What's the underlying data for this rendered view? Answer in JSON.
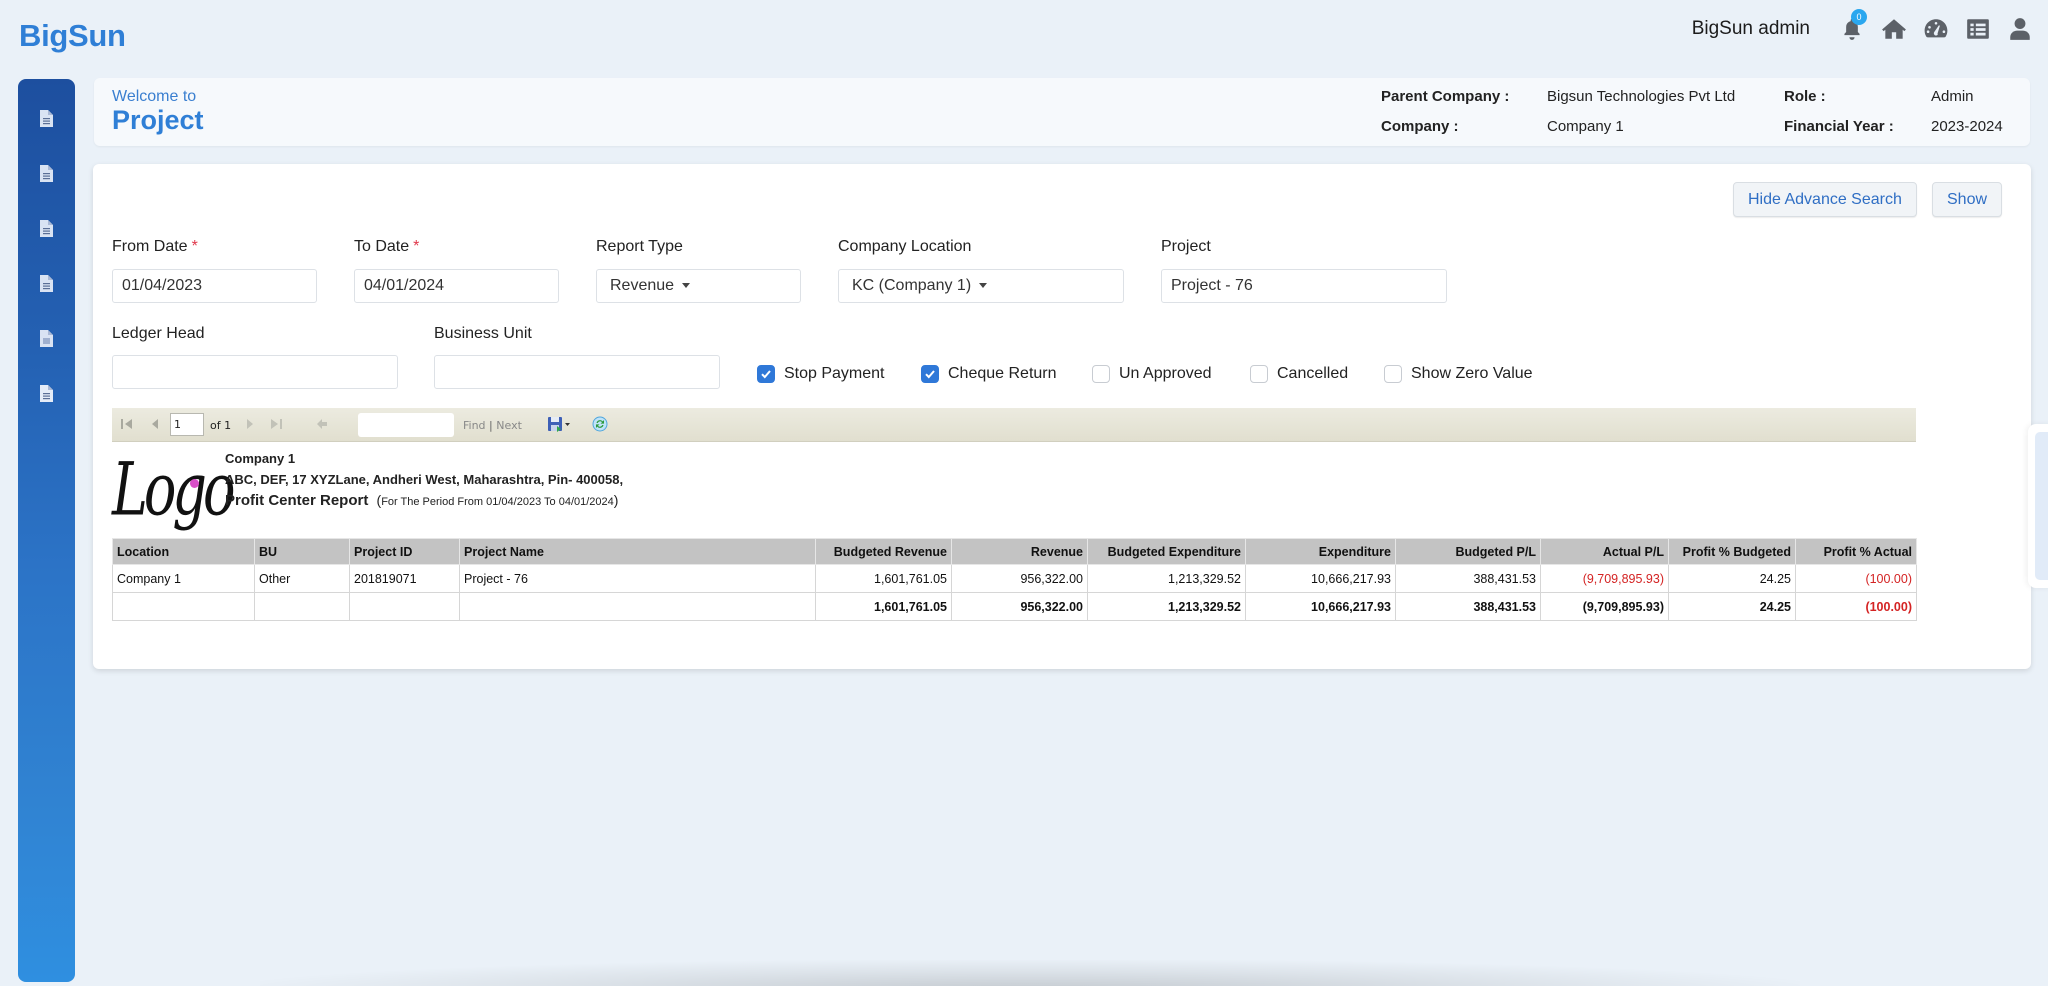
{
  "app": {
    "brand": "BigSun"
  },
  "topbar": {
    "username": "BigSun admin",
    "notification_count": "0",
    "icons": [
      "bell-icon",
      "home-icon",
      "dashboard-icon",
      "list-icon",
      "user-icon"
    ]
  },
  "sidebar": {
    "items": [
      {
        "icon": "document-icon"
      },
      {
        "icon": "document-icon"
      },
      {
        "icon": "document-icon"
      },
      {
        "icon": "document-icon"
      },
      {
        "icon": "document-icon"
      },
      {
        "icon": "document-icon"
      }
    ]
  },
  "header": {
    "welcome": "Welcome to",
    "title": "Project",
    "parent_company_label": "Parent Company :",
    "parent_company_value": "Bigsun Technologies Pvt Ltd",
    "company_label": "Company :",
    "company_value": "Company 1",
    "role_label": "Role :",
    "role_value": "Admin",
    "fy_label": "Financial Year :",
    "fy_value": "2023-2024"
  },
  "actions": {
    "hide_advance_search": "Hide Advance Search",
    "show": "Show"
  },
  "filters": {
    "from_date": {
      "label": "From Date",
      "required": "*",
      "value": "01/04/2023"
    },
    "to_date": {
      "label": "To Date",
      "required": "*",
      "value": "04/01/2024"
    },
    "report_type": {
      "label": "Report Type",
      "value": "Revenue"
    },
    "company_location": {
      "label": "Company Location",
      "value": "KC (Company 1)"
    },
    "project": {
      "label": "Project",
      "value": "Project - 76"
    },
    "ledger_head": {
      "label": "Ledger Head",
      "value": ""
    },
    "business_unit": {
      "label": "Business Unit",
      "value": ""
    },
    "checkboxes": [
      {
        "label": "Stop Payment",
        "checked": true
      },
      {
        "label": "Cheque Return",
        "checked": true
      },
      {
        "label": "Un Approved",
        "checked": false
      },
      {
        "label": "Cancelled",
        "checked": false
      },
      {
        "label": "Show Zero Value",
        "checked": false
      }
    ]
  },
  "report_viewer": {
    "page": "1",
    "of_pages": "of 1",
    "find_label": "Find",
    "separator": "|",
    "next_label": "Next",
    "find_value": ""
  },
  "report": {
    "logo_text": "Logo",
    "company": "Company 1",
    "address": "ABC, DEF, 17 XYZLane, Andheri West, Maharashtra, Pin- 400058,",
    "title": "Profit Center Report",
    "period_open": "(",
    "period": "For The Period From 01/04/2023 To 04/01/2024",
    "period_close": ")",
    "columns": [
      "Location",
      "BU",
      "Project ID",
      "Project Name",
      "Budgeted Revenue",
      "Revenue",
      "Budgeted Expenditure",
      "Expenditure",
      "Budgeted P/L",
      "Actual P/L",
      "Profit % Budgeted",
      "Profit % Actual"
    ],
    "rows": [
      [
        "Company 1",
        "Other",
        "201819071",
        "Project - 76",
        "1,601,761.05",
        "956,322.00",
        "1,213,329.52",
        "10,666,217.93",
        "388,431.53",
        "(9,709,895.93)",
        "24.25",
        "(100.00)"
      ]
    ],
    "total": [
      "",
      "",
      "",
      "",
      "1,601,761.05",
      "956,322.00",
      "1,213,329.52",
      "10,666,217.93",
      "388,431.53",
      "(9,709,895.93)",
      "24.25",
      "(100.00)"
    ]
  },
  "colors": {
    "brand": "#2f7fd6",
    "negative": "#d42323",
    "checkbox_on": "#2f78d8",
    "badge": "#2aa7ef"
  }
}
